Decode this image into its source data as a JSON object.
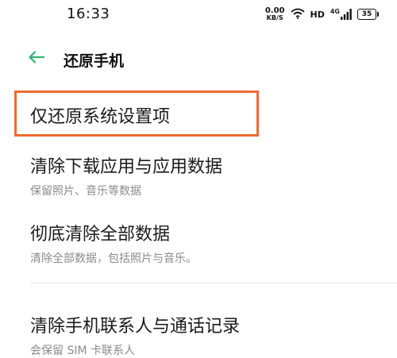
{
  "status_bar": {
    "time": "16:33",
    "net_speed_value": "0.00",
    "net_speed_unit": "KB/S",
    "hd_label": "HD",
    "signal_label": "4G",
    "battery_level": "35"
  },
  "header": {
    "title": "还原手机"
  },
  "options": [
    {
      "title": "仅还原系统设置项",
      "desc": ""
    },
    {
      "title": "清除下载应用与应用数据",
      "desc": "保留照片、音乐等数据"
    },
    {
      "title": "彻底清除全部数据",
      "desc": "清除全部数据，包括照片与音乐。"
    },
    {
      "title": "清除手机联系人与通话记录",
      "desc": "会保留 SIM 卡联系人"
    }
  ],
  "colors": {
    "accent": "#2fb36a",
    "highlight": "#ee6b2f",
    "text_primary": "#1a1a1a",
    "text_secondary": "#8a8a8a"
  }
}
